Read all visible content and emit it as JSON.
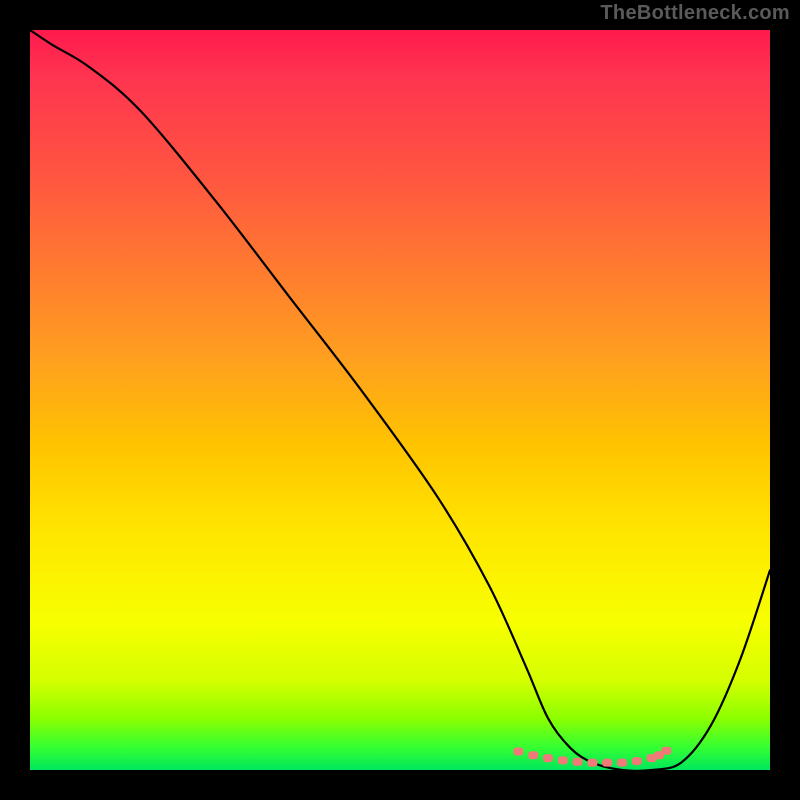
{
  "watermark": "TheBottleneck.com",
  "chart_data": {
    "type": "line",
    "title": "",
    "xlabel": "",
    "ylabel": "",
    "xlim": [
      0,
      100
    ],
    "ylim": [
      0,
      100
    ],
    "gradient_stops": [
      {
        "pct": 0,
        "color": "#ff1a4d"
      },
      {
        "pct": 20,
        "color": "#ff5640"
      },
      {
        "pct": 44,
        "color": "#ff9e20"
      },
      {
        "pct": 68,
        "color": "#ffe600"
      },
      {
        "pct": 88,
        "color": "#d4ff00"
      },
      {
        "pct": 97,
        "color": "#33ff33"
      },
      {
        "pct": 100,
        "color": "#00e65c"
      }
    ],
    "series": [
      {
        "name": "bottleneck-curve",
        "color": "#000000",
        "x": [
          0,
          3,
          8,
          15,
          25,
          35,
          45,
          55,
          62,
          67,
          70,
          73,
          76,
          80,
          84,
          88,
          92,
          96,
          100
        ],
        "y": [
          100,
          98,
          95,
          89,
          77,
          64,
          51,
          37,
          25,
          14,
          7,
          3,
          1,
          0,
          0,
          1,
          6,
          15,
          27
        ]
      },
      {
        "name": "optimal-band",
        "color": "#f07a78",
        "type": "scatter",
        "x": [
          66,
          68,
          70,
          72,
          74,
          76,
          78,
          80,
          82,
          84,
          85,
          86
        ],
        "y": [
          2.5,
          2.0,
          1.6,
          1.3,
          1.1,
          1.0,
          1.0,
          1.0,
          1.2,
          1.6,
          2.0,
          2.6
        ]
      }
    ],
    "annotations": []
  }
}
